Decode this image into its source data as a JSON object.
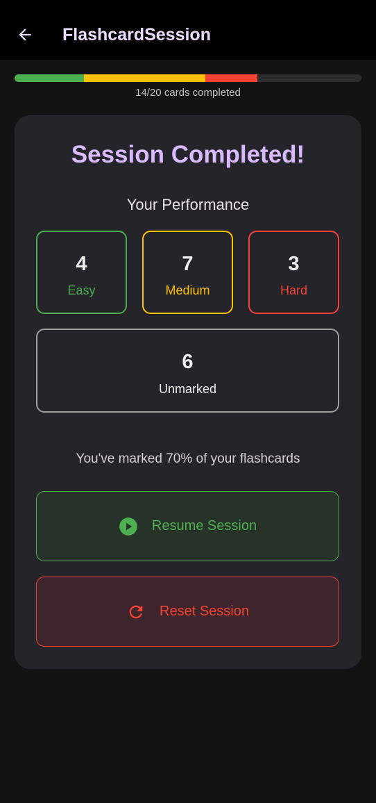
{
  "app_bar": {
    "title": "FlashcardSession",
    "back_icon": "arrow-left-icon"
  },
  "progress": {
    "completed": 14,
    "total": 20,
    "label": "14/20 cards completed",
    "segments": [
      {
        "name": "Easy",
        "count": 4,
        "color": "#4caf50"
      },
      {
        "name": "Medium",
        "count": 7,
        "color": "#ffc107"
      },
      {
        "name": "Hard",
        "count": 3,
        "color": "#f44336"
      }
    ],
    "track_color": "#2c2c2c"
  },
  "summary": {
    "title": "Session Completed!",
    "performance_heading": "Your Performance",
    "stats": {
      "easy": {
        "value": "4",
        "label": "Easy",
        "color": "#4caf50"
      },
      "medium": {
        "value": "7",
        "label": "Medium",
        "color": "#ffc107"
      },
      "hard": {
        "value": "3",
        "label": "Hard",
        "color": "#f44336"
      },
      "unmarked": {
        "value": "6",
        "label": "Unmarked",
        "color": "#9e9e9e"
      }
    },
    "marked_text": "You've marked 70% of your flashcards"
  },
  "actions": {
    "resume": {
      "label": "Resume Session",
      "icon": "play-circle-icon",
      "color": "#4caf50"
    },
    "reset": {
      "label": "Reset Session",
      "icon": "refresh-icon",
      "color": "#f44336"
    }
  }
}
